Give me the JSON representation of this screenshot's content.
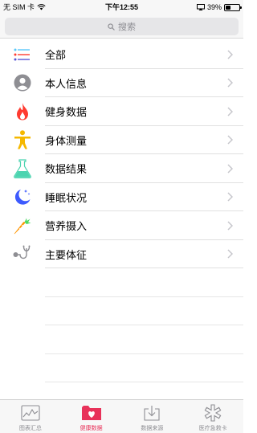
{
  "status_bar": {
    "carrier": "无 SIM 卡",
    "time": "下午12:55",
    "battery_percent": "39%",
    "battery_level": 0.39
  },
  "search": {
    "placeholder": "搜索"
  },
  "menu": {
    "items": [
      {
        "label": "全部",
        "icon": "list-icon"
      },
      {
        "label": "本人信息",
        "icon": "person-icon"
      },
      {
        "label": "健身数据",
        "icon": "flame-icon"
      },
      {
        "label": "身体测量",
        "icon": "body-icon"
      },
      {
        "label": "数据结果",
        "icon": "flask-icon"
      },
      {
        "label": "睡眠状况",
        "icon": "moon-icon"
      },
      {
        "label": "营养摄入",
        "icon": "carrot-icon"
      },
      {
        "label": "主要体征",
        "icon": "stethoscope-icon"
      }
    ]
  },
  "tabs": [
    {
      "label": "图表汇总",
      "icon": "chart-icon",
      "active": false
    },
    {
      "label": "健康数据",
      "icon": "health-folder-icon",
      "active": true
    },
    {
      "label": "数据来源",
      "icon": "download-icon",
      "active": false
    },
    {
      "label": "医疗急救卡",
      "icon": "medical-star-icon",
      "active": false
    }
  ],
  "colors": {
    "accent": "#e8325a",
    "list_bars": [
      "#5ac8fa",
      "#ff3b30",
      "#5856d6"
    ],
    "person": "#8e8e93",
    "flame": "#ff3b30",
    "body": "#f5b800",
    "flask": "#4cd4b0",
    "moon": "#3d5afe",
    "carrot": "#ff9500",
    "stethoscope": "#8e8e93"
  }
}
